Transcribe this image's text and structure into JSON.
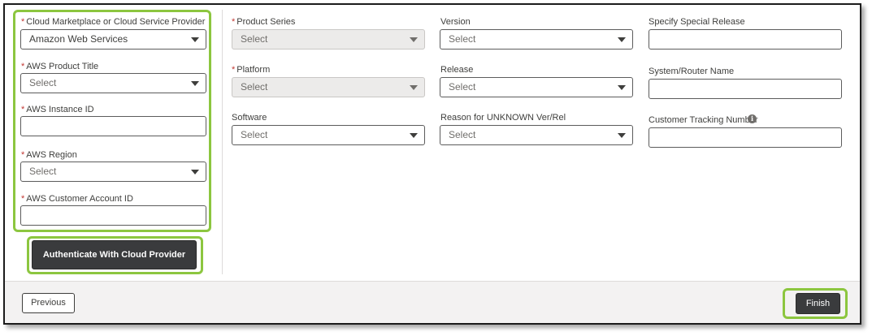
{
  "left_panel": {
    "cloud_provider": {
      "label": "Cloud Marketplace or Cloud Service Provider",
      "value": "Amazon Web Services"
    },
    "product_title": {
      "label": "AWS Product Title",
      "value": "Select"
    },
    "instance_id": {
      "label": "AWS Instance ID",
      "value": ""
    },
    "region": {
      "label": "AWS Region",
      "value": "Select"
    },
    "customer_account_id": {
      "label": "AWS Customer Account ID",
      "value": ""
    },
    "authenticate_label": "Authenticate With Cloud Provider"
  },
  "col2": {
    "product_series": {
      "label": "Product Series",
      "value": "Select"
    },
    "platform": {
      "label": "Platform",
      "value": "Select"
    },
    "software": {
      "label": "Software",
      "value": "Select"
    }
  },
  "col3": {
    "version": {
      "label": "Version",
      "value": "Select"
    },
    "release": {
      "label": "Release",
      "value": "Select"
    },
    "reason_unknown": {
      "label": "Reason for UNKNOWN Ver/Rel",
      "value": "Select"
    }
  },
  "col4": {
    "special_release": {
      "label": "Specify Special Release",
      "value": ""
    },
    "system_router_name": {
      "label": "System/Router Name",
      "value": ""
    },
    "customer_tracking_number": {
      "label": "Customer Tracking Number",
      "value": "",
      "info_icon": "info-icon"
    }
  },
  "footer": {
    "previous_label": "Previous",
    "finish_label": "Finish"
  },
  "colors": {
    "highlight": "#8cc63f",
    "required": "#c23934",
    "button_dark": "#3a3b3d"
  }
}
